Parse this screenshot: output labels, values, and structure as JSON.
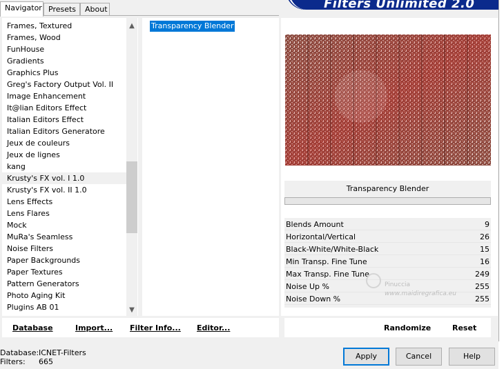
{
  "tabs": [
    "Navigator",
    "Presets",
    "About"
  ],
  "logo_text": "Filters Unlimited 2.0",
  "categories": [
    "Frames, Textured",
    "Frames, Wood",
    "FunHouse",
    "Gradients",
    "Graphics Plus",
    "Greg's Factory Output Vol. II",
    "Image Enhancement",
    "It@lian Editors Effect",
    "Italian Editors Effect",
    "Italian Editors Generatore",
    "Jeux de couleurs",
    "Jeux de lignes",
    "kang",
    "Krusty's FX vol. I 1.0",
    "Krusty's FX vol. II 1.0",
    "Lens Effects",
    "Lens Flares",
    "Mock",
    "MuRa's Seamless",
    "Noise Filters",
    "Paper Backgrounds",
    "Paper Textures",
    "Pattern Generators",
    "Photo Aging Kit",
    "Plugins AB 01"
  ],
  "selected_category": "Krusty's FX vol. I 1.0",
  "filters": [
    "Transparency Blender"
  ],
  "filter_title": "Transparency Blender",
  "params": [
    {
      "label": "Blends Amount",
      "value": "9"
    },
    {
      "label": "Horizontal/Vertical",
      "value": "26"
    },
    {
      "label": "Black-White/White-Black",
      "value": "15"
    },
    {
      "label": "Min Transp. Fine Tune",
      "value": "16"
    },
    {
      "label": "Max Transp. Fine Tune",
      "value": "249"
    },
    {
      "label": "Noise Up %",
      "value": "255"
    },
    {
      "label": "Noise Down %",
      "value": "255"
    }
  ],
  "watermark": {
    "line1": "Pinuccia",
    "line2": "www.maidiregrafica.eu"
  },
  "buttons_left": [
    "Database",
    "Import...",
    "Filter Info...",
    "Editor..."
  ],
  "buttons_right": [
    "Randomize",
    "Reset"
  ],
  "status": {
    "database_label": "Database:",
    "database_value": "ICNET-Filters",
    "filters_label": "Filters:",
    "filters_value": "665"
  },
  "dialog_buttons": [
    "Apply",
    "Cancel",
    "Help"
  ],
  "colors": {
    "selection": "#0078d7",
    "logo": "#0b2a8c",
    "preview": "#9a6050"
  }
}
